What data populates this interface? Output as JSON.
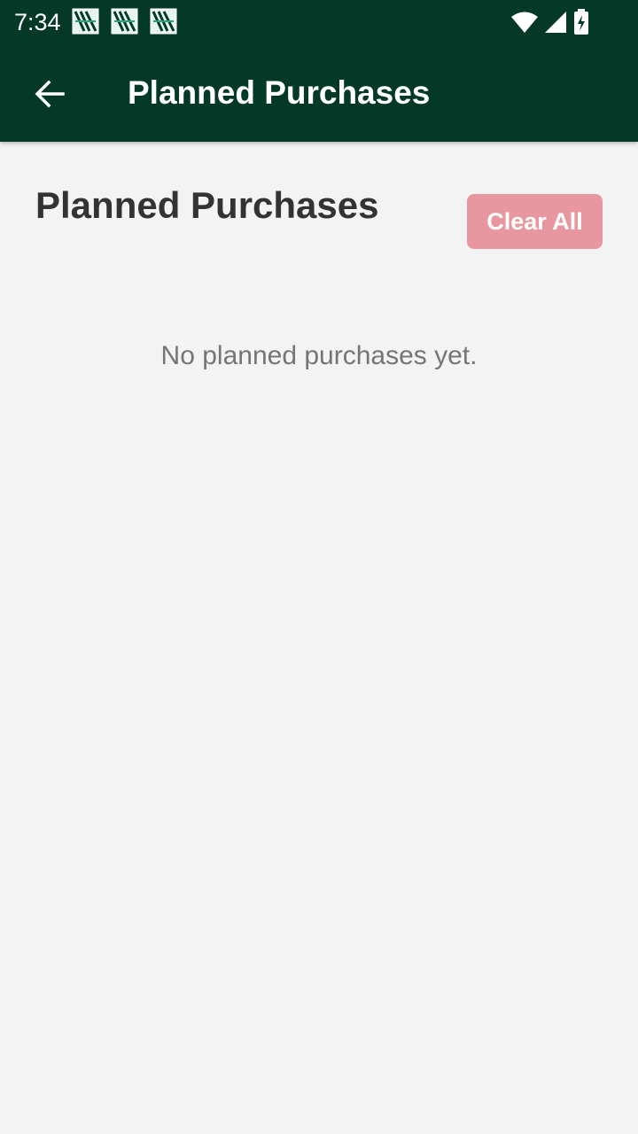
{
  "status_bar": {
    "time": "7:34",
    "notification_icons": [
      "app-notification-icon",
      "app-notification-icon",
      "app-notification-icon"
    ],
    "system_icons": [
      "wifi-icon",
      "cellular-signal-icon",
      "battery-charging-icon"
    ]
  },
  "app_bar": {
    "back_icon": "arrow-left-icon",
    "title": "Planned Purchases"
  },
  "content": {
    "heading": "Planned Purchases",
    "clear_all_label": "Clear All",
    "empty_message": "No planned purchases yet."
  },
  "colors": {
    "app_bar_background": "#043927",
    "page_background": "#f3f3f3",
    "heading_text": "#333333",
    "clear_button_background": "#e8969f",
    "empty_text": "#757575"
  }
}
